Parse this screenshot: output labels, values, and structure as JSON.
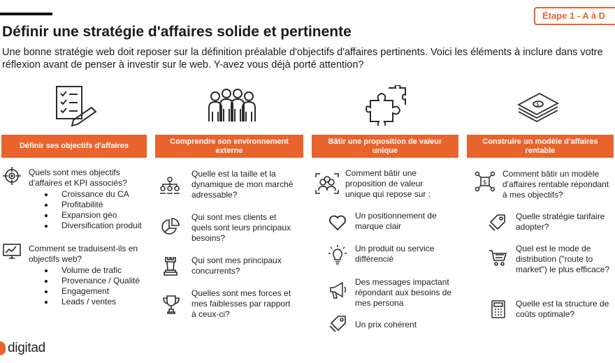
{
  "stage_badge": "Étape 1 - A à D",
  "title": "Définir une stratégie d'affaires solide et pertinente",
  "intro": "Une bonne stratégie web doit reposer sur la définition préalable d'objectifs d'affaires pertinents. Voici les éléments à inclure dans votre réflexion avant de penser à investir sur le web. Y-avez vous déjà porté attention?",
  "colors": {
    "accent": "#e8642c",
    "text": "#1f1f1f",
    "icon": "#2b2b2b"
  },
  "columns": [
    {
      "header": "Définir ses objectifs d'affaires",
      "icon": "checklist-pencil-icon",
      "items": [
        {
          "icon": "target-icon",
          "text": "Quels sont mes objectifs d'affaires et KPI associés?",
          "bullets": [
            "Croissance du CA",
            "Profitabilité",
            "Expansion géo",
            "Diversification produit"
          ]
        },
        {
          "icon": "monitor-chart-icon",
          "text": "Comment se traduisent-ils en objectifs web?",
          "bullets": [
            "Volume de trafic",
            "Provenance / Qualité",
            "Engagement",
            "Leads / ventes"
          ]
        }
      ]
    },
    {
      "header": "Comprendre son environnement externe",
      "icon": "people-group-icon",
      "items": [
        {
          "icon": "org-chart-icon",
          "text": "Quelle est la taille et la dynamique de mon marché adressable?"
        },
        {
          "icon": "pie-chart-icon",
          "text": "Qui sont mes clients et quels sont leurs principaux besoins?"
        },
        {
          "icon": "chess-rook-icon",
          "text": "Qui sont mes principaux concurrents?"
        },
        {
          "icon": "trophy-icon",
          "text": "Quelles sont mes forces et mes faiblesses par rapport à ceux-ci?"
        }
      ]
    },
    {
      "header": "Bâtir une proposition de valeur unique",
      "icon": "puzzle-icon",
      "items": [
        {
          "icon": "target-persona-icon",
          "text": "Comment bâtir une proposition de valeur unique qui repose sur :"
        },
        {
          "icon": "heart-icon",
          "text": "Un positionnement de marque clair"
        },
        {
          "icon": "lightbulb-icon",
          "text": "Un produit ou service différencié"
        },
        {
          "icon": "megaphone-icon",
          "text": "Des messages impactant répondant aux besoins de mes persona"
        },
        {
          "icon": "price-tag-icon",
          "text": "Un prix cohérent"
        }
      ]
    },
    {
      "header": "Construire un modèle d'affaires rentable",
      "icon": "money-stack-icon",
      "items": [
        {
          "icon": "money-network-icon",
          "text": "Comment bâtir un modèle d'affaires rentable répondant à mes objectifs?"
        },
        {
          "icon": "price-tag-icon",
          "text": "Quelle stratégie tarifaire adopter?"
        },
        {
          "icon": "shopping-cart-icon",
          "text": "Quel est le mode de distribution (\"route to market\") le plus efficace?"
        },
        {
          "icon": "calculator-icon",
          "text": "Quelle est la structure de coûts optimale?"
        }
      ]
    }
  ],
  "brand": "digitad"
}
